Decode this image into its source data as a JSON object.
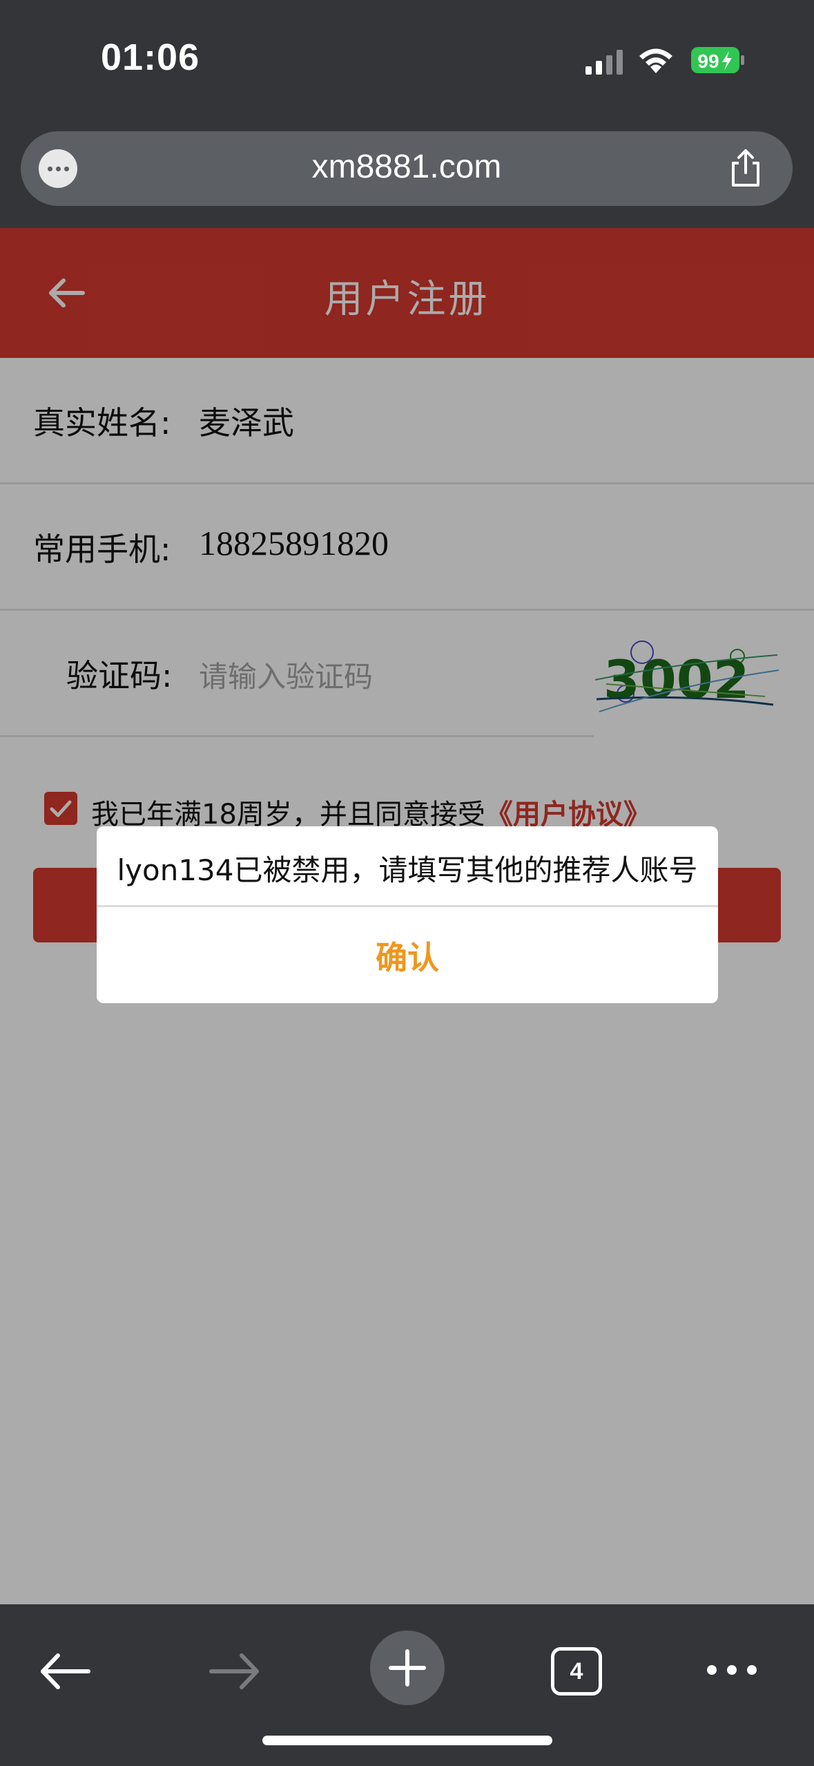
{
  "status_bar": {
    "time": "01:06",
    "battery_level": "99"
  },
  "browser": {
    "url": "xm8881.com",
    "tab_count": "4"
  },
  "header": {
    "title": "用户注册"
  },
  "form": {
    "name_label": "真实姓名:",
    "name_value": "麦泽武",
    "phone_label": "常用手机:",
    "phone_value": "18825891820",
    "captcha_label": "验证码:",
    "captcha_placeholder": "请输入验证码",
    "captcha_image_text": "3002",
    "agree_text": "我已年满18周岁，并且同意接受",
    "agree_link": "《用户协议》",
    "agree_checked": true
  },
  "dialog": {
    "message": "lyon134已被禁用，请填写其他的推荐人账号",
    "confirm_label": "确认"
  },
  "colors": {
    "brand": "#d63a2f",
    "confirm": "#f0961e",
    "chrome": "#343538"
  },
  "icons": {
    "header_back": "arrow-left-icon",
    "url_menu": "ellipsis-icon",
    "share": "share-icon",
    "toolbar_back": "arrow-left-icon",
    "toolbar_forward": "arrow-right-icon",
    "toolbar_new_tab": "plus-icon",
    "toolbar_more": "more-icon"
  }
}
